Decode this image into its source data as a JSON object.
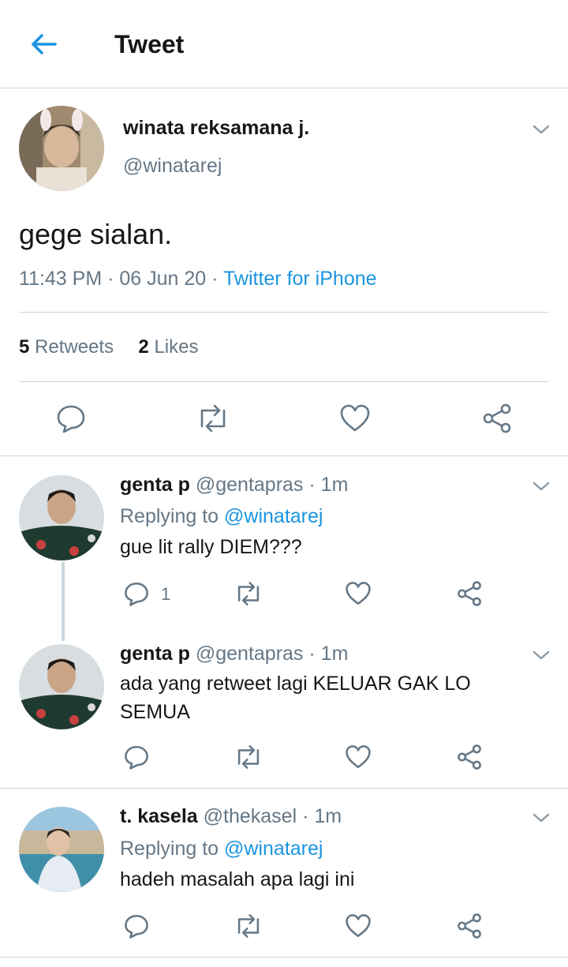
{
  "header": {
    "title": "Tweet",
    "back_icon": "arrow-left-icon"
  },
  "main_tweet": {
    "name": "winata reksamana j.",
    "handle": "@winatarej",
    "text": "gege sialan.",
    "time": "11:43 PM",
    "date": "06 Jun 20",
    "source": "Twitter for iPhone",
    "sep": "·",
    "retweets_count": "5",
    "retweets_label": "Retweets",
    "likes_count": "2",
    "likes_label": "Likes"
  },
  "replies": [
    {
      "name": "genta p",
      "handle": "@gentapras",
      "time": "1m",
      "sep": "·",
      "replying_label": "Replying to",
      "replying_to": "@winatarej",
      "text": "gue lit rally DIEM???",
      "reply_count": "1"
    },
    {
      "name": "genta p",
      "handle": "@gentapras",
      "time": "1m",
      "sep": "·",
      "text_line1": "ada yang retweet lagi KELUAR GAK LO",
      "text_line2": "SEMUA"
    },
    {
      "name": "t. kasela",
      "handle": "@thekasel",
      "time": "1m",
      "sep": "·",
      "replying_label": "Replying to",
      "replying_to": "@winatarej",
      "text": "hadeh masalah apa lagi ini"
    }
  ],
  "colors": {
    "accent": "#1b95e0",
    "muted": "#657786",
    "divider": "#ccd6dd"
  }
}
